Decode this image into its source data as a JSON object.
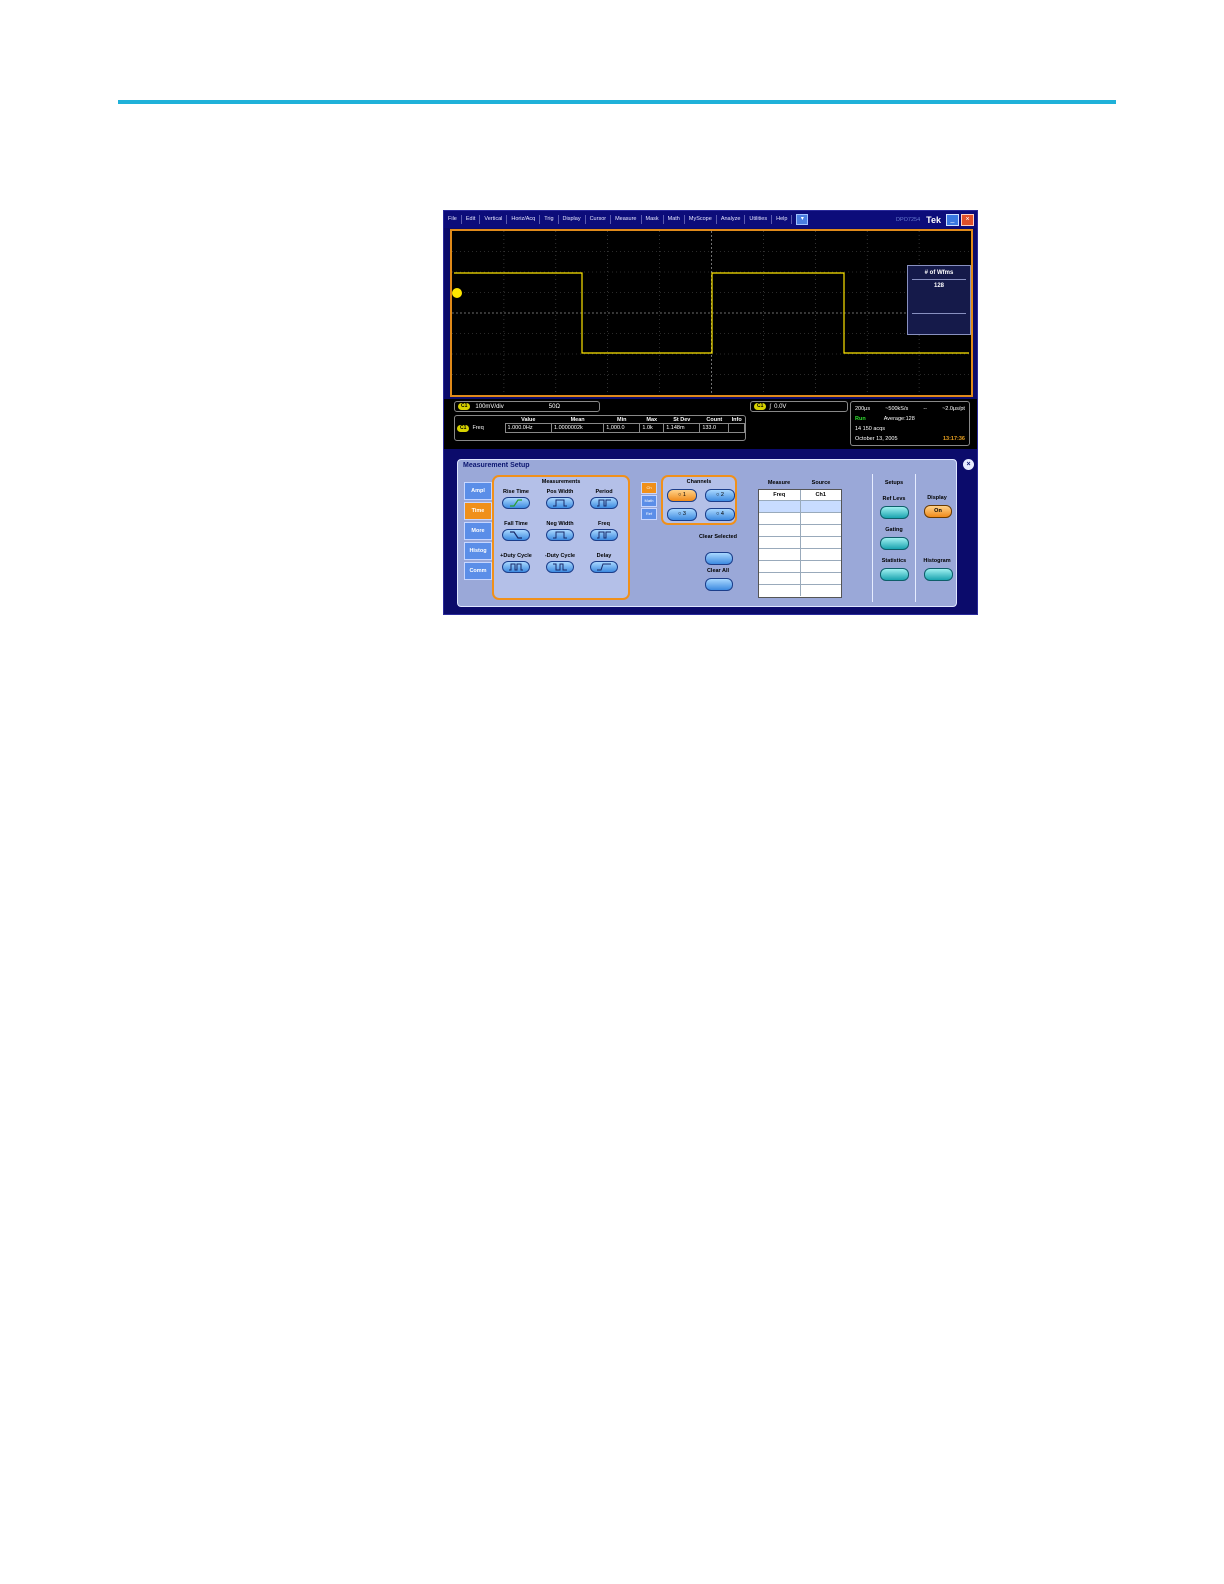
{
  "menu": [
    "File",
    "Edit",
    "Vertical",
    "Horiz/Acq",
    "Trig",
    "Display",
    "Cursor",
    "Measure",
    "Mask",
    "Math",
    "MyScope",
    "Analyze",
    "Utilities",
    "Help"
  ],
  "model": "DPO7254",
  "brand": "Tek",
  "wfms": {
    "title": "# of Wfms",
    "value": "128"
  },
  "channel_bar": {
    "badge": "C1",
    "scale": "100mV/div",
    "impedance": "50Ω"
  },
  "trigger_bar": {
    "badge": "C1",
    "level": "0.0V"
  },
  "measure_table": {
    "headers": [
      "Value",
      "Mean",
      "Min",
      "Max",
      "St Dev",
      "Count",
      "Info"
    ],
    "row": {
      "badge": "C1",
      "label": "Freq",
      "values": [
        "1.000.0Hz",
        "1.0000002k",
        "1,000.0",
        "1.0k",
        "1.148m",
        "133.0",
        ""
      ]
    }
  },
  "acq": {
    "timebase": "200μs",
    "rate": "~500kS/s",
    "dash": "--",
    "pt": "~2.0μs/pt",
    "state": "Run",
    "average": "Average:128",
    "acqs": "14 150 acqs",
    "date": "October 13, 2005",
    "time": "13:17:36"
  },
  "setup": {
    "title": "Measurement Setup",
    "close": "×",
    "tabs": [
      "Ampl",
      "Time",
      "More",
      "Histog",
      "Comm"
    ],
    "active_tab": "Time",
    "group_title": "Measurements",
    "buttons": [
      "Rise Time",
      "Pos Width",
      "Period",
      "Fall Time",
      "Neg Width",
      "Freq",
      "+Duty Cycle",
      "-Duty Cycle",
      "Delay"
    ],
    "side_tabs": [
      "Ch",
      "Math",
      "Ref"
    ],
    "channels_title": "Channels",
    "channels": [
      "1",
      "2",
      "3",
      "4"
    ],
    "clear_selected": "Clear Selected",
    "clear_all": "Clear All",
    "table_headers": [
      "Measure",
      "Source"
    ],
    "table_row": [
      "Freq",
      "Ch1"
    ],
    "setups_title": "Setups",
    "ref_levs": "Ref Levs",
    "gating": "Gating",
    "statistics": "Statistics",
    "display": "Display",
    "display_state": "On",
    "histogram": "Histogram"
  },
  "colors": {
    "accent": "#1fb1d9",
    "trace": "#ffe600",
    "orange": "#f0901a"
  }
}
